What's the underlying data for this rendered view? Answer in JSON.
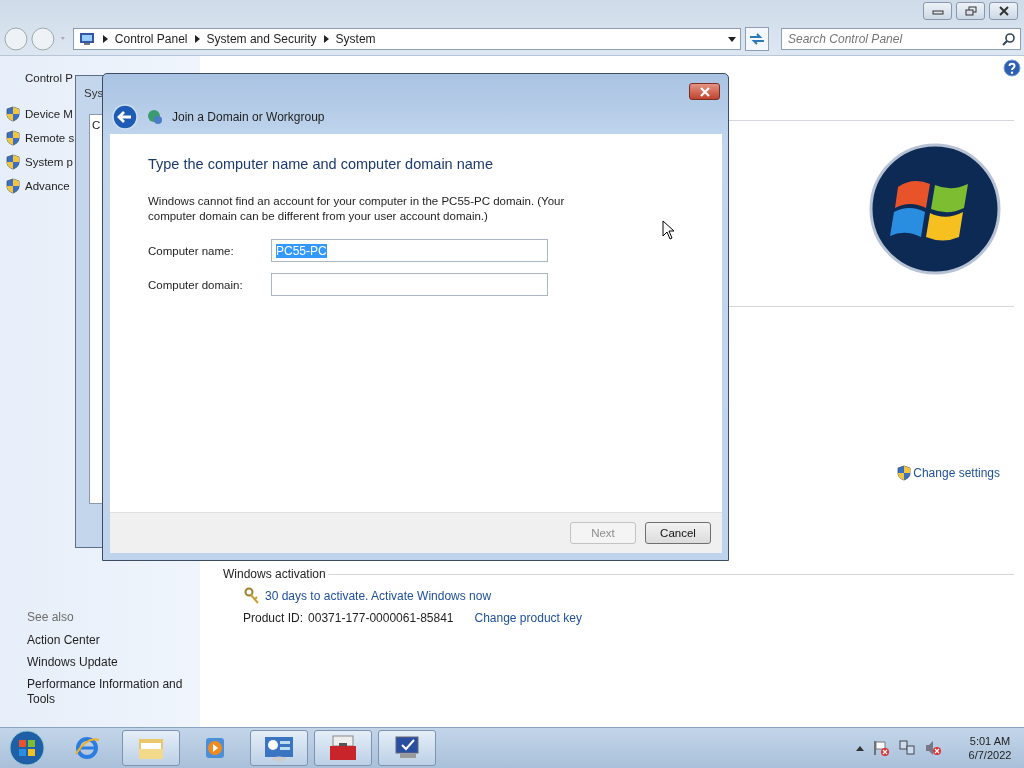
{
  "window": {
    "breadcrumb": [
      "Control Panel",
      "System and Security",
      "System"
    ],
    "search": {
      "placeholder": "Search Control Panel"
    }
  },
  "sidebar": {
    "home": "Control P",
    "tasks": [
      "Device M",
      "Remote s",
      "System p",
      "Advance"
    ],
    "see_also": {
      "title": "See also",
      "links": [
        "Action Center",
        "Windows Update",
        "Performance Information and Tools"
      ]
    }
  },
  "main": {
    "change_settings": "Change settings",
    "activation": {
      "heading": "Windows activation",
      "status_link": "30 days to activate. Activate Windows now",
      "product_id_label": "Product ID:",
      "product_id": "00371-177-0000061-85841",
      "change_key_link": "Change product key"
    }
  },
  "background_dialog": {
    "title": "Sys",
    "content": "C"
  },
  "dialog": {
    "title": "Join a Domain or Workgroup",
    "heading": "Type the computer name and computer domain name",
    "message": "Windows cannot find an account for your computer in the PC55-PC domain. (Your computer domain can be different from your user account domain.)",
    "fields": [
      {
        "label": "Computer name:",
        "value": "PC55-PC",
        "value_selected": true
      },
      {
        "label": "Computer domain:"
      }
    ],
    "buttons": [
      {
        "label": "Next",
        "disabled": true
      },
      {
        "label": "Cancel",
        "disabled": false
      }
    ]
  },
  "taskbar": {
    "items": [
      {
        "kind": "browser",
        "running": false
      },
      {
        "kind": "folder",
        "running": true
      },
      {
        "kind": "media",
        "running": false
      },
      {
        "kind": "control-panel",
        "running": true
      },
      {
        "kind": "toolbox",
        "running": true
      },
      {
        "kind": "monitor",
        "running": true
      }
    ],
    "clock": {
      "time": "5:01 AM",
      "date": "6/7/2022"
    }
  }
}
